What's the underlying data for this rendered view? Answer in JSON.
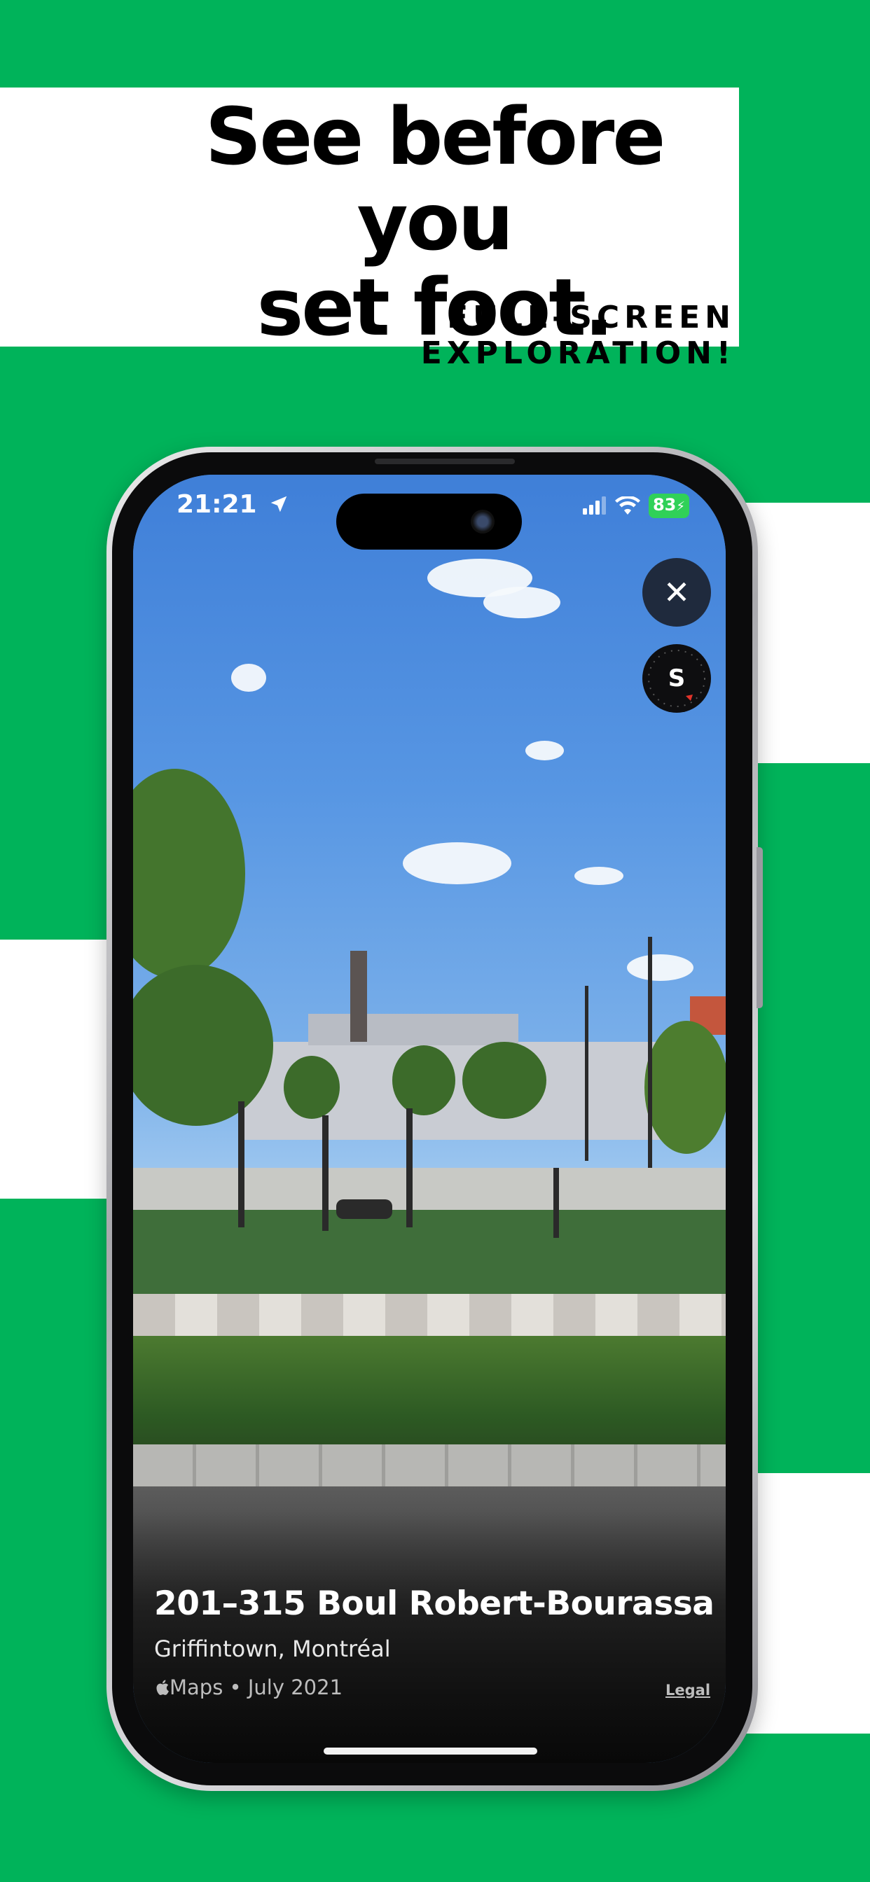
{
  "promo": {
    "headline_line1": "See before you",
    "headline_line2": "set foot.",
    "subline": "FULL-SCREEN EXPLORATION!"
  },
  "status_bar": {
    "time": "21:21",
    "battery": "83"
  },
  "controls": {
    "close_symbol": "✕",
    "compass_direction": "S"
  },
  "place": {
    "address": "201–315 Boul Robert-Bourassa",
    "area": "Griffintown, Montréal",
    "source": "Maps • July 2021",
    "legal": "Legal"
  },
  "colors": {
    "background_green": "#00b35a",
    "stripe_white": "#ffffff",
    "close_button": "#1f2a3d",
    "battery_green": "#30d158"
  },
  "icons": [
    "location-arrow-icon",
    "signal-icon",
    "wifi-icon",
    "battery-icon",
    "close-icon",
    "compass-icon",
    "apple-logo-icon"
  ]
}
